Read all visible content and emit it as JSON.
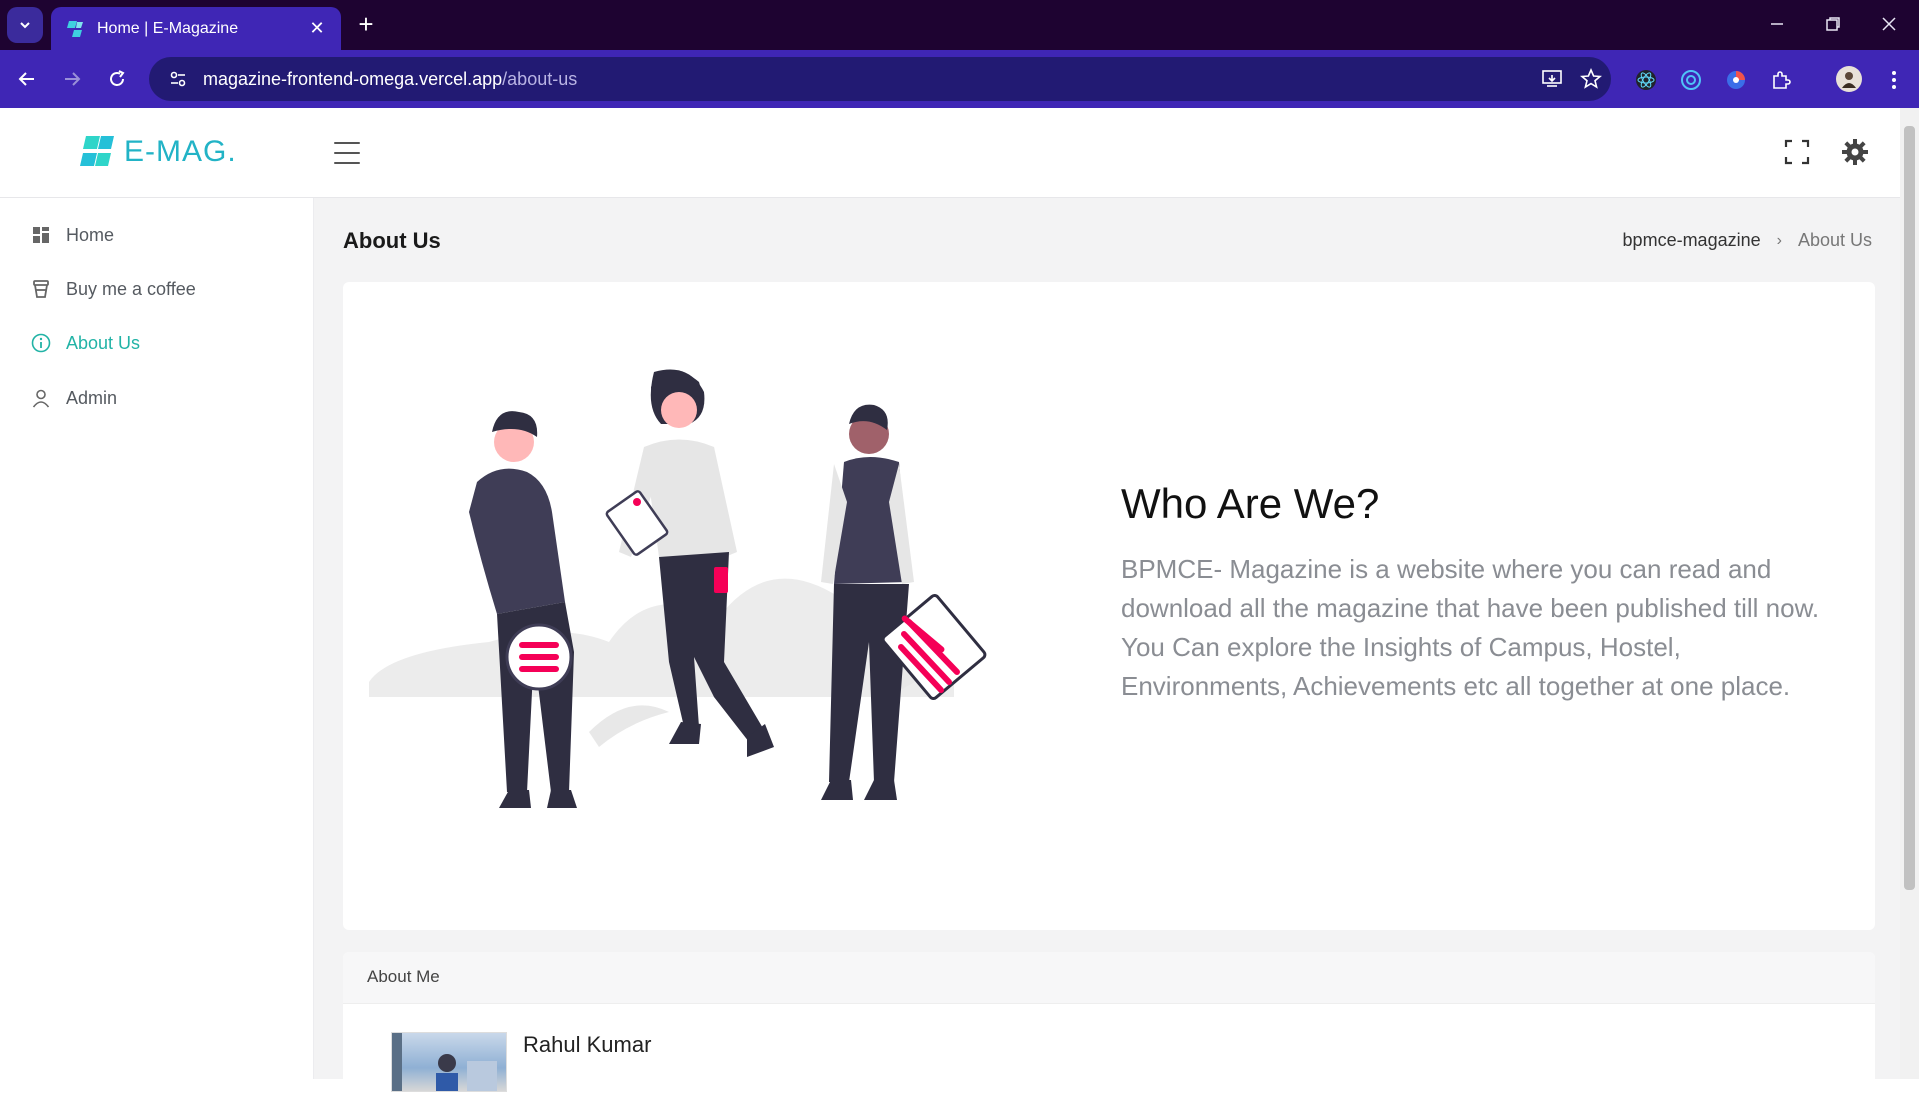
{
  "browser": {
    "tab_title": "Home | E-Magazine",
    "url_host": "magazine-frontend-omega.vercel.app",
    "url_path": "/about-us"
  },
  "header": {
    "logo_text": "E-MAG",
    "logo_dot": "."
  },
  "sidebar": {
    "items": [
      {
        "label": "Home",
        "icon": "grid-icon"
      },
      {
        "label": "Buy me a coffee",
        "icon": "coffee-cup-icon"
      },
      {
        "label": "About Us",
        "icon": "info-icon",
        "active": true
      },
      {
        "label": "Admin",
        "icon": "user-icon"
      }
    ]
  },
  "main": {
    "page_title": "About Us",
    "breadcrumb": {
      "root": "bpmce-magazine",
      "current": "About Us"
    },
    "hero": {
      "title": "Who Are We?",
      "text": "BPMCE- Magazine is a website where you can read and download all the magazine that have been published till now. You Can explore the Insights of Campus, Hostel, Environments, Achievements etc all together at one place."
    },
    "about_me": {
      "heading": "About Me",
      "name": "Rahul Kumar"
    }
  },
  "colors": {
    "accent": "#22b3a6",
    "browser_tab": "#3f26b5",
    "browser_bg": "#1e0331",
    "illustration_accent": "#f50057"
  }
}
